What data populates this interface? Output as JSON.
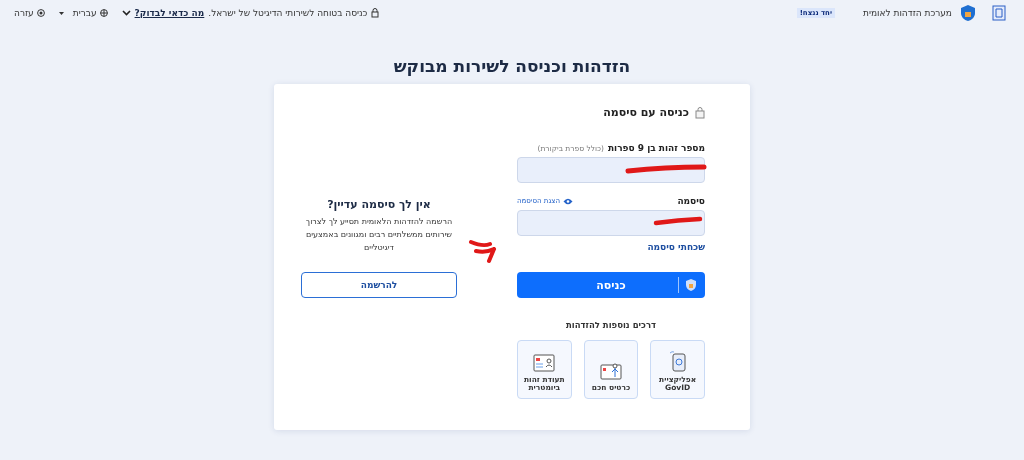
{
  "header": {
    "brand": "מערכת הזדהות לאומית",
    "badge": "יחד ננצח!",
    "security_note": "כניסה בטוחה לשירותי הדיגיטל של ישראל.",
    "security_link": "מה כדאי לבדוק?",
    "language": "עברית",
    "help": "עזרה"
  },
  "title": "הזדהות וכניסה לשירות מבוקש",
  "login": {
    "heading": "כניסה עם סיסמה",
    "id_label": "מספר זהות בן 9 ספרות",
    "id_hint": "(כולל ספרת ביקורת)",
    "password_label": "סיסמה",
    "show_password": "הצגת הסיסמה",
    "forgot": "שכחתי סיסמה",
    "submit": "כניסה"
  },
  "other_methods": {
    "heading": "דרכים נוספות להזדהות",
    "items": [
      {
        "kind": "app",
        "label": "אפליקציית GovID"
      },
      {
        "kind": "card",
        "label": "כרטיס חכם"
      },
      {
        "kind": "biometric",
        "label": "תעודת זהות ביומטרית"
      }
    ]
  },
  "signup": {
    "heading": "אין לך סיסמה עדיין?",
    "text": "הרשמה להזדהות הלאומית תסייע לך לצרוך שירותים ממשלתיים רבים ומגוונים באמצעים דיגיטליים",
    "button": "להרשמה"
  }
}
